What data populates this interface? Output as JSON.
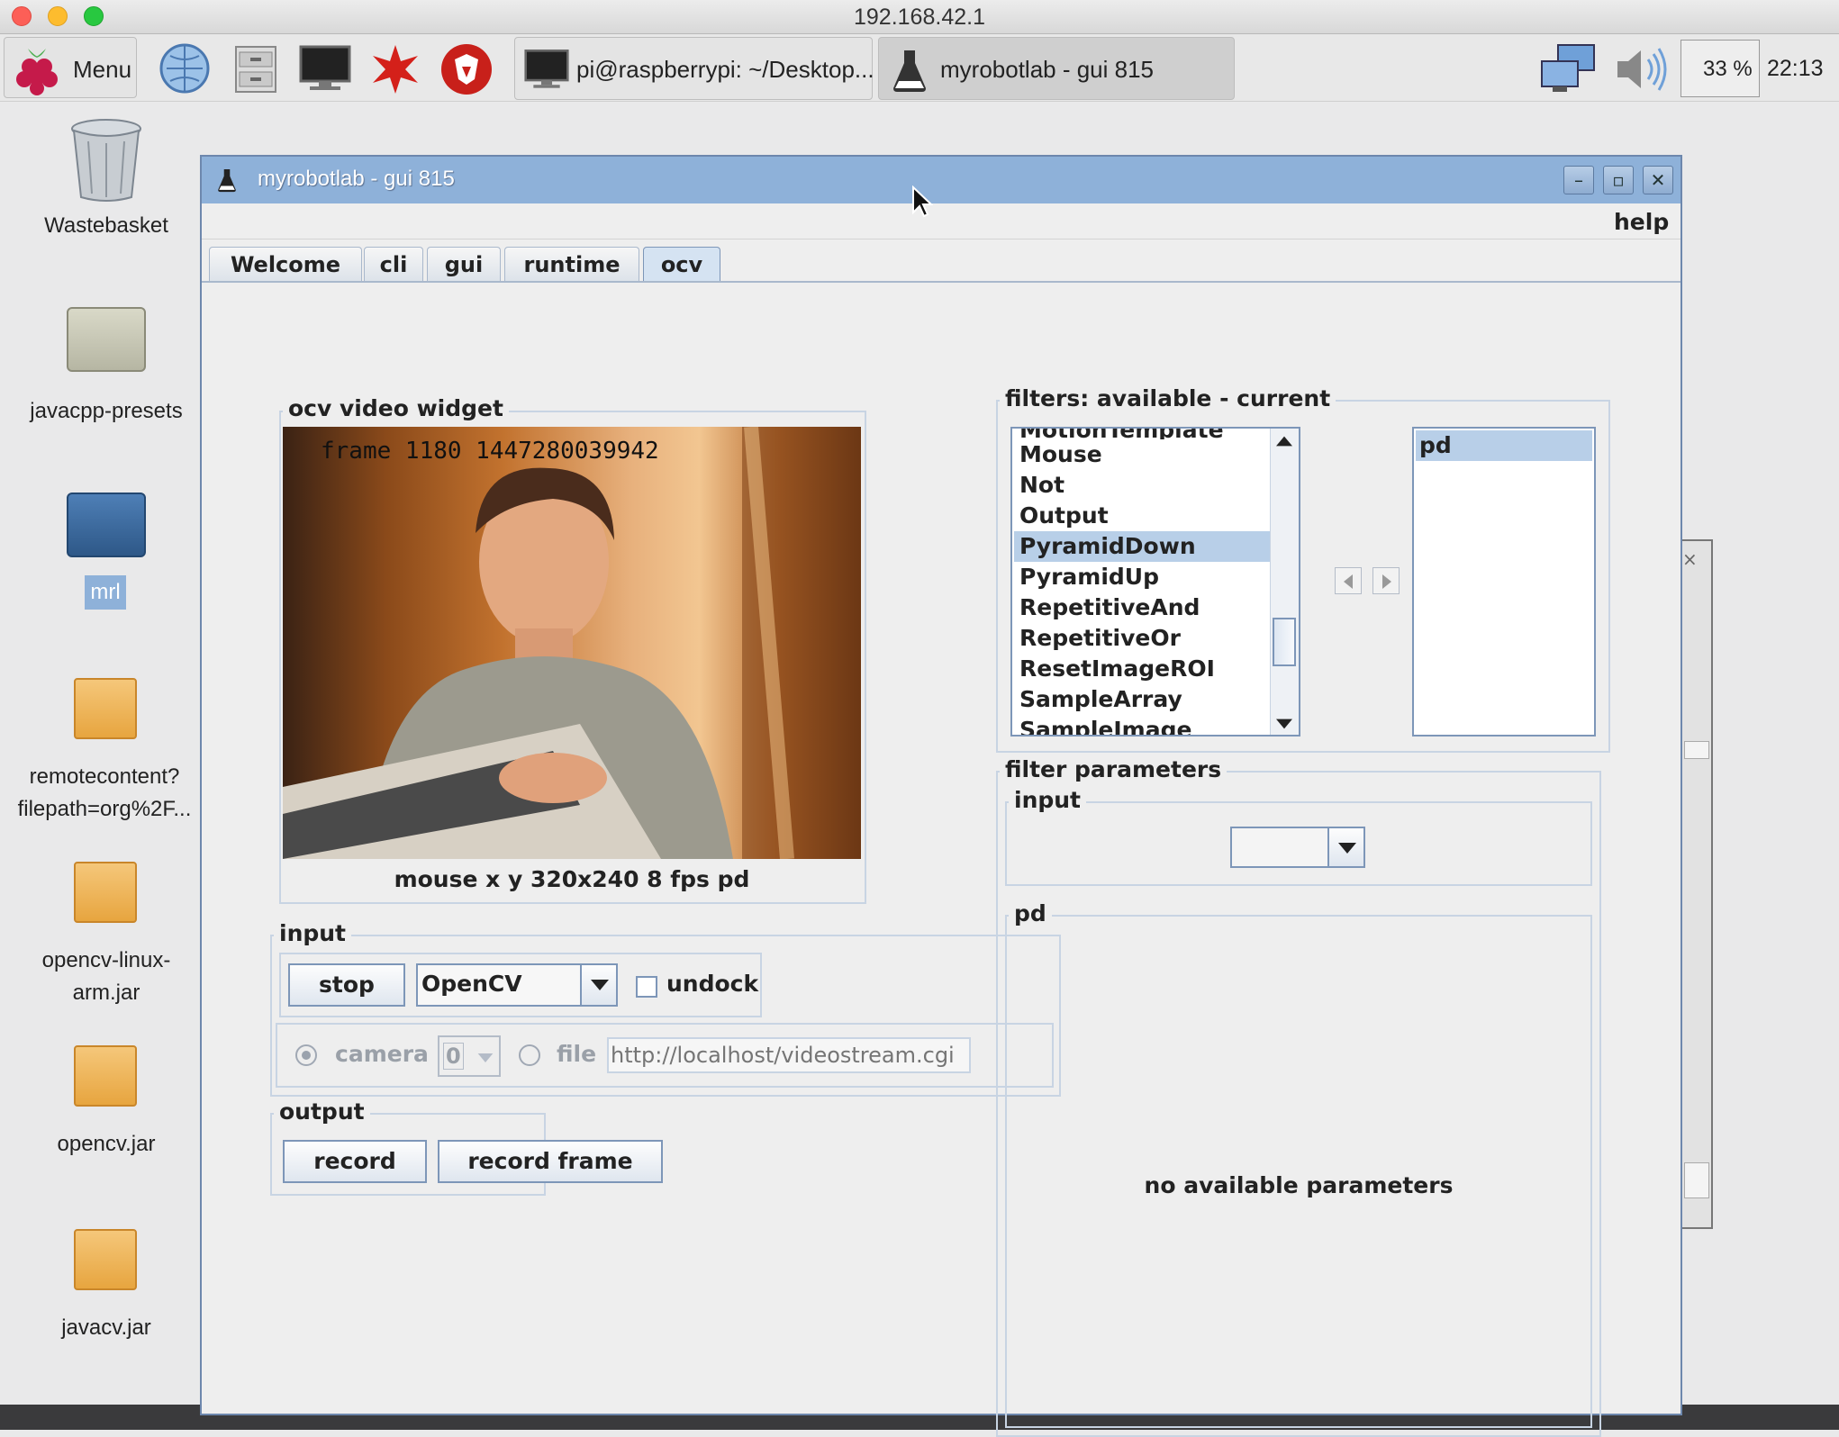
{
  "host_title": "192.168.42.1",
  "panel": {
    "menu_label": "Menu",
    "task_terminal": "pi@raspberrypi: ~/Desktop...",
    "task_mrl": "myrobotlab - gui 815",
    "cpu": "33 %",
    "clock": "22:13"
  },
  "desktop_icons": {
    "wastebasket": "Wastebasket",
    "javacpp": "javacpp-presets",
    "mrl": "mrl",
    "remote_1": "remotecontent?",
    "remote_2": "filepath=org%2F...",
    "opencv_linux_1": "opencv-linux-",
    "opencv_linux_2": "arm.jar",
    "opencv": "opencv.jar",
    "javacv": "javacv.jar"
  },
  "window": {
    "title": "myrobotlab - gui 815",
    "help": "help",
    "tabs": [
      "Welcome",
      "cli",
      "gui",
      "runtime",
      "ocv"
    ],
    "active_tab": "ocv"
  },
  "video": {
    "group_label": "ocv  video widget",
    "overlay": "frame 1180 1447280039942",
    "status": "mouse x y 320x240 8 fps pd"
  },
  "input": {
    "group_label": "input",
    "stop": "stop",
    "grabber": "OpenCV",
    "undock": "undock",
    "camera": "camera",
    "camera_index": "0",
    "file": "file",
    "file_placeholder": "http://localhost/videostream.cgi"
  },
  "output": {
    "group_label": "output",
    "record": "record",
    "record_frame": "record frame"
  },
  "filters": {
    "group_label": "filters: available - current",
    "available": [
      "Mouse",
      "Not",
      "Output",
      "PyramidDown",
      "PyramidUp",
      "RepetitiveAnd",
      "RepetitiveOr",
      "ResetImageROI",
      "SampleArray",
      "SampleImage"
    ],
    "selected_available": "PyramidDown",
    "current": [
      "pd"
    ]
  },
  "params": {
    "group_label": "filter parameters",
    "input_label": "input",
    "pd_label": "pd",
    "none": "no available parameters"
  },
  "colors": {
    "titlebar": "#8eb1d9",
    "selection": "#b8cfe8",
    "group_border": "#c8d4e3"
  }
}
